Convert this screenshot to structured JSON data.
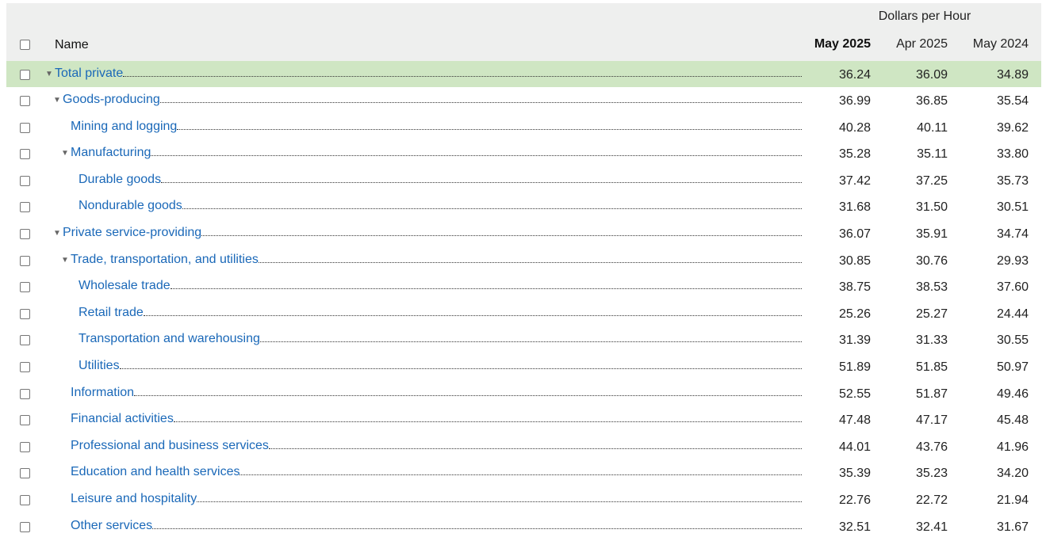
{
  "header": {
    "group_title": "Dollars per Hour",
    "name_col": "Name",
    "columns": [
      "May 2025",
      "Apr 2025",
      "May 2024"
    ]
  },
  "rows": [
    {
      "label": "Total private",
      "level": 0,
      "expanded": true,
      "highlighted": true,
      "values": [
        "36.24",
        "36.09",
        "34.89"
      ]
    },
    {
      "label": "Goods-producing",
      "level": 1,
      "expanded": true,
      "values": [
        "36.99",
        "36.85",
        "35.54"
      ]
    },
    {
      "label": "Mining and logging",
      "level": 2,
      "values": [
        "40.28",
        "40.11",
        "39.62"
      ]
    },
    {
      "label": "Manufacturing",
      "level": 2,
      "expanded": true,
      "values": [
        "35.28",
        "35.11",
        "33.80"
      ]
    },
    {
      "label": "Durable goods",
      "level": 3,
      "values": [
        "37.42",
        "37.25",
        "35.73"
      ]
    },
    {
      "label": "Nondurable goods",
      "level": 3,
      "values": [
        "31.68",
        "31.50",
        "30.51"
      ]
    },
    {
      "label": "Private service-providing",
      "level": 1,
      "expanded": true,
      "values": [
        "36.07",
        "35.91",
        "34.74"
      ]
    },
    {
      "label": "Trade, transportation, and utilities",
      "level": 2,
      "expanded": true,
      "values": [
        "30.85",
        "30.76",
        "29.93"
      ]
    },
    {
      "label": "Wholesale trade",
      "level": 3,
      "values": [
        "38.75",
        "38.53",
        "37.60"
      ]
    },
    {
      "label": "Retail trade",
      "level": 3,
      "values": [
        "25.26",
        "25.27",
        "24.44"
      ]
    },
    {
      "label": "Transportation and warehousing",
      "level": 3,
      "values": [
        "31.39",
        "31.33",
        "30.55"
      ]
    },
    {
      "label": "Utilities",
      "level": 3,
      "values": [
        "51.89",
        "51.85",
        "50.97"
      ]
    },
    {
      "label": "Information",
      "level": 2,
      "values": [
        "52.55",
        "51.87",
        "49.46"
      ]
    },
    {
      "label": "Financial activities",
      "level": 2,
      "values": [
        "47.48",
        "47.17",
        "45.48"
      ]
    },
    {
      "label": "Professional and business services",
      "level": 2,
      "values": [
        "44.01",
        "43.76",
        "41.96"
      ]
    },
    {
      "label": "Education and health services",
      "level": 2,
      "values": [
        "35.39",
        "35.23",
        "34.20"
      ]
    },
    {
      "label": "Leisure and hospitality",
      "level": 2,
      "values": [
        "22.76",
        "22.72",
        "21.94"
      ]
    },
    {
      "label": "Other services",
      "level": 2,
      "values": [
        "32.51",
        "32.41",
        "31.67"
      ]
    }
  ],
  "colors": {
    "link": "#1a68b8",
    "highlight": "#cfe6c3",
    "header_bg": "#eeefee"
  },
  "icons": {
    "expanded": "caret-down-icon"
  }
}
